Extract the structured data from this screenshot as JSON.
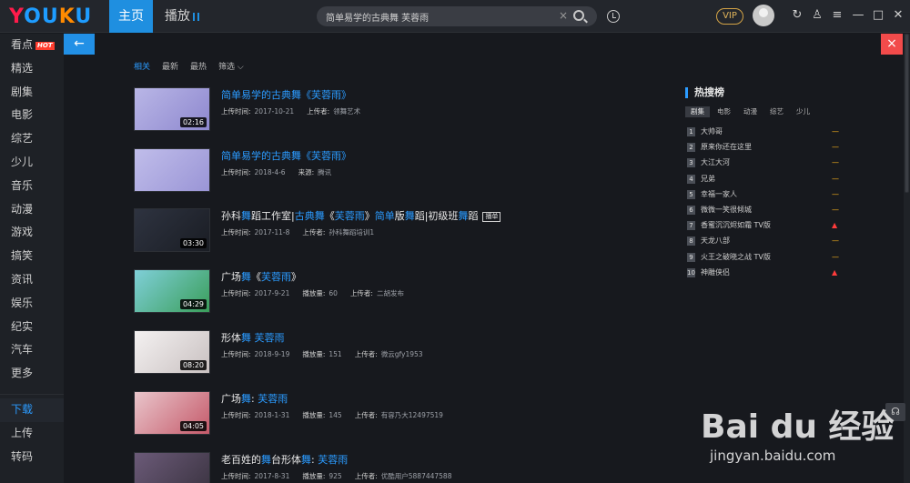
{
  "header": {
    "logo": "YOUKU",
    "nav_home": "主页",
    "nav_play": "播放",
    "search_value": "简单易学的古典舞 芙蓉雨",
    "clear_glyph": "×",
    "vip_label": "VIP"
  },
  "sidebar": {
    "items": [
      {
        "label": "看点",
        "badge": "HOT"
      },
      {
        "label": "精选"
      },
      {
        "label": "剧集"
      },
      {
        "label": "电影"
      },
      {
        "label": "综艺"
      },
      {
        "label": "少儿"
      },
      {
        "label": "音乐"
      },
      {
        "label": "动漫"
      },
      {
        "label": "游戏"
      },
      {
        "label": "搞笑"
      },
      {
        "label": "资讯"
      },
      {
        "label": "娱乐"
      },
      {
        "label": "纪实"
      },
      {
        "label": "汽车"
      },
      {
        "label": "更多"
      }
    ],
    "bottom": [
      {
        "label": "下载"
      },
      {
        "label": "上传"
      },
      {
        "label": "转码"
      }
    ]
  },
  "controls": {
    "back_glyph": "←",
    "close_glyph": "×"
  },
  "filters": [
    "相关",
    "最新",
    "最热",
    "筛选 ⌵"
  ],
  "results": [
    {
      "title_parts": [
        {
          "t": "简单易学的古典舞《芙蓉雨》",
          "hl": true
        }
      ],
      "duration": "02:16",
      "meta": [
        {
          "label": "上传时间:",
          "value": "2017-10-21"
        },
        {
          "label": "上传者:",
          "value": "领舞艺术"
        }
      ],
      "thumb_colors": [
        "#b9b6e6",
        "#8e88cf"
      ]
    },
    {
      "title_parts": [
        {
          "t": "简单易学的古典舞《芙蓉雨》",
          "hl": true
        }
      ],
      "duration": "",
      "meta": [
        {
          "label": "上传时间:",
          "value": "2018-4-6"
        },
        {
          "label": "来源:",
          "value": "腾讯"
        }
      ],
      "thumb_colors": [
        "#c0bdea",
        "#9a95d6"
      ]
    },
    {
      "title_parts": [
        {
          "t": "孙科",
          "hl": false
        },
        {
          "t": "舞",
          "hl": true
        },
        {
          "t": "蹈工作室|",
          "hl": false
        },
        {
          "t": "古典舞",
          "hl": true
        },
        {
          "t": "《",
          "hl": false
        },
        {
          "t": "芙蓉雨",
          "hl": true
        },
        {
          "t": "》",
          "hl": false
        },
        {
          "t": "简单",
          "hl": true
        },
        {
          "t": "版",
          "hl": false
        },
        {
          "t": "舞",
          "hl": true
        },
        {
          "t": "蹈|初级班",
          "hl": false
        },
        {
          "t": "舞",
          "hl": true
        },
        {
          "t": "蹈",
          "hl": false
        }
      ],
      "badge": "播单",
      "duration": "03:30",
      "meta": [
        {
          "label": "上传时间:",
          "value": "2017-11-8"
        },
        {
          "label": "上传者:",
          "value": "孙科舞蹈培训1"
        }
      ],
      "thumb_colors": [
        "#2e3340",
        "#1a1d24"
      ]
    },
    {
      "title_parts": [
        {
          "t": "广场",
          "hl": false
        },
        {
          "t": "舞",
          "hl": true
        },
        {
          "t": "《",
          "hl": false
        },
        {
          "t": "芙蓉雨",
          "hl": true
        },
        {
          "t": "》",
          "hl": false
        }
      ],
      "duration": "04:29",
      "meta": [
        {
          "label": "上传时间:",
          "value": "2017-9-21"
        },
        {
          "label": "播放量:",
          "value": "60"
        },
        {
          "label": "上传者:",
          "value": "二胡发布"
        }
      ],
      "thumb_colors": [
        "#7fcfd8",
        "#3a9e5a"
      ]
    },
    {
      "title_parts": [
        {
          "t": "形体",
          "hl": false
        },
        {
          "t": "舞",
          "hl": true
        },
        {
          "t": " ",
          "hl": false
        },
        {
          "t": "芙蓉雨",
          "hl": true
        }
      ],
      "duration": "08:20",
      "meta": [
        {
          "label": "上传时间:",
          "value": "2018-9-19"
        },
        {
          "label": "播放量:",
          "value": "151"
        },
        {
          "label": "上传者:",
          "value": "微云gfy1953"
        }
      ],
      "thumb_colors": [
        "#f4f1f1",
        "#c9c1c1"
      ]
    },
    {
      "title_parts": [
        {
          "t": "广场",
          "hl": false
        },
        {
          "t": "舞",
          "hl": true
        },
        {
          "t": ": ",
          "hl": false
        },
        {
          "t": "芙蓉雨",
          "hl": true
        }
      ],
      "duration": "04:05",
      "meta": [
        {
          "label": "上传时间:",
          "value": "2018-1-31"
        },
        {
          "label": "播放量:",
          "value": "145"
        },
        {
          "label": "上传者:",
          "value": "有容乃大12497519"
        }
      ],
      "thumb_colors": [
        "#e9c5cb",
        "#c55a6a"
      ]
    },
    {
      "title_parts": [
        {
          "t": "老百姓的",
          "hl": false
        },
        {
          "t": "舞",
          "hl": true
        },
        {
          "t": "台形体",
          "hl": false
        },
        {
          "t": "舞",
          "hl": true
        },
        {
          "t": ": ",
          "hl": false
        },
        {
          "t": "芙蓉雨",
          "hl": true
        }
      ],
      "duration": "",
      "meta": [
        {
          "label": "上传时间:",
          "value": "2017-8-31"
        },
        {
          "label": "播放量:",
          "value": "925"
        },
        {
          "label": "上传者:",
          "value": "优酷用户5887447588"
        }
      ],
      "thumb_colors": [
        "#6b5a78",
        "#3a3340"
      ]
    }
  ],
  "hot_search": {
    "title": "热搜榜",
    "tabs": [
      "剧集",
      "电影",
      "动漫",
      "综艺",
      "少儿"
    ],
    "items": [
      {
        "rank": "1",
        "name": "大帅哥",
        "trend": "flat"
      },
      {
        "rank": "2",
        "name": "原来你还在这里",
        "trend": "flat"
      },
      {
        "rank": "3",
        "name": "大江大河",
        "trend": "flat"
      },
      {
        "rank": "4",
        "name": "兄弟",
        "trend": "flat"
      },
      {
        "rank": "5",
        "name": "幸福一家人",
        "trend": "flat"
      },
      {
        "rank": "6",
        "name": "微微一笑很倾城",
        "trend": "flat"
      },
      {
        "rank": "7",
        "name": "香蜜沉沉烬如霜 TV版",
        "trend": "up"
      },
      {
        "rank": "8",
        "name": "天龙八部",
        "trend": "flat"
      },
      {
        "rank": "9",
        "name": "火王之破晓之战 TV版",
        "trend": "flat"
      },
      {
        "rank": "10",
        "name": "神雕侠侣",
        "trend": "up"
      }
    ],
    "trend_glyphs": {
      "flat": "—",
      "up": "▲"
    }
  },
  "watermark": {
    "main": "Bai du 经验",
    "sub": "jingyan.baidu.com"
  },
  "colors": {
    "accent": "#2b9bff",
    "brand_red": "#ff1b4b",
    "vip_gold": "#d4a446"
  }
}
